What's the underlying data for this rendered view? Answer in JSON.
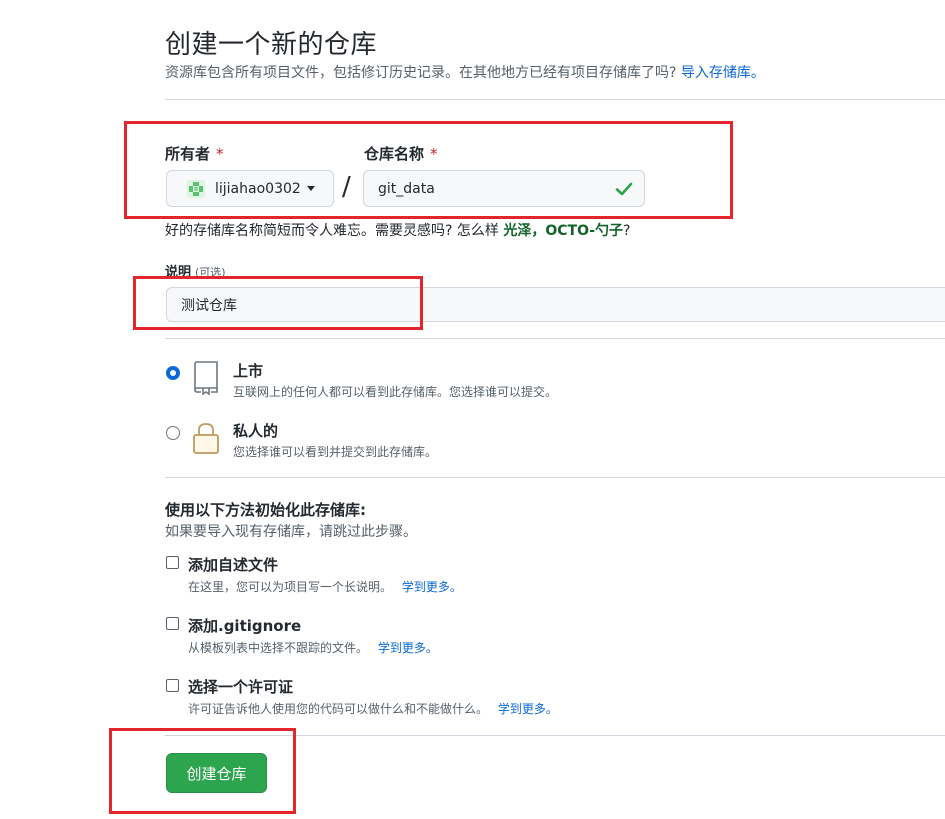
{
  "header": {
    "title": "创建一个新的仓库",
    "subtitle": "资源库包含所有项目文件，包括修订历史记录。在其他地方已经有项目存储库了吗?",
    "import_link": "导入存储库。"
  },
  "owner": {
    "label": "所有者",
    "required_mark": "*",
    "value": "lijiahao0302"
  },
  "separator": "/",
  "repo_name": {
    "label": "仓库名称",
    "required_mark": "*",
    "value": "git_data"
  },
  "name_hint": {
    "text": "好的存储库名称简短而令人难忘。需要灵感吗? 怎么样",
    "suggestion": "光泽，OCTO-勺子",
    "suffix": "?"
  },
  "description": {
    "label": "说明",
    "optional": "(可选)",
    "value": "测试仓库"
  },
  "visibility": {
    "public": {
      "title": "上市",
      "subtitle": "互联网上的任何人都可以看到此存储库。您选择谁可以提交。",
      "selected": true
    },
    "private": {
      "title": "私人的",
      "subtitle": "您选择谁可以看到并提交到此存储库。",
      "selected": false
    }
  },
  "init": {
    "title": "使用以下方法初始化此存储库:",
    "subtitle": "如果要导入现有存储库，请跳过此步骤。",
    "readme": {
      "title": "添加自述文件",
      "subtitle": "在这里，您可以为项目写一个长说明。",
      "link": "学到更多。",
      "checked": false
    },
    "gitignore": {
      "title": "添加.gitignore",
      "subtitle": "从模板列表中选择不跟踪的文件。",
      "link": "学到更多。",
      "checked": false
    },
    "license": {
      "title": "选择一个许可证",
      "subtitle": "许可证告诉他人使用您的代码可以做什么和不能做什么。",
      "link": "学到更多。",
      "checked": false
    }
  },
  "submit": {
    "label": "创建仓库"
  },
  "colors": {
    "accent": "#0969da",
    "primary_button": "#2da44e",
    "annotation": "#e3262b",
    "suggestion": "#116329"
  }
}
